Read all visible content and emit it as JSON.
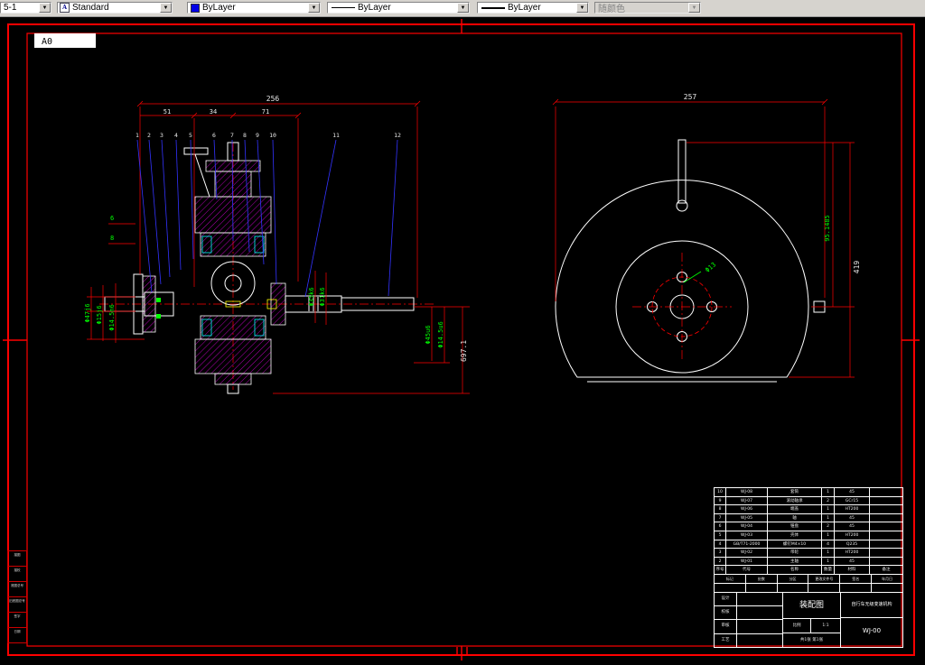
{
  "toolbar": {
    "layer": "5-1",
    "text_style": "Standard",
    "color": "ByLayer",
    "linetype": "ByLayer",
    "lineweight": "ByLayer",
    "plot_style": "随颜色"
  },
  "icons": {
    "text_style_glyph": "A"
  },
  "sheet": {
    "size_label": "A0"
  },
  "left_view": {
    "dim_total": "256",
    "dim_a": "51",
    "dim_b": "34",
    "dim_c": "71",
    "callouts": [
      "1",
      "2",
      "3",
      "4",
      "5",
      "6",
      "7",
      "8",
      "9",
      "10",
      "11",
      "12"
    ],
    "fit_left": [
      "Φ47j6",
      "Φ15j6",
      "Φ14.5n6"
    ],
    "fit_mid": [
      "Φ35k6",
      "Φ31k6"
    ],
    "fit_right": [
      "Φ45u6",
      "Φ14.5u6"
    ],
    "dim_right": "697.1",
    "notes": [
      "6",
      "8"
    ]
  },
  "right_view": {
    "dim_total": "257",
    "dim_v1": "95.1485",
    "dim_v2": "419",
    "hole": "Φ13"
  },
  "title_block": {
    "bom": {
      "rows": [
        [
          "10",
          "WJ-08",
          "套筒",
          "1",
          "45",
          ""
        ],
        [
          "9",
          "WJ-07",
          "滚动轴承",
          "2",
          "GCr15",
          ""
        ],
        [
          "8",
          "WJ-06",
          "端盖",
          "1",
          "HT200",
          ""
        ],
        [
          "7",
          "WJ-05",
          "轴",
          "1",
          "45",
          ""
        ],
        [
          "6",
          "WJ-04",
          "锥盘",
          "2",
          "45",
          ""
        ],
        [
          "5",
          "WJ-03",
          "壳体",
          "1",
          "HT200",
          ""
        ],
        [
          "4",
          "GB/T71-2000",
          "螺钉M4×10",
          "4",
          "Q235",
          ""
        ],
        [
          "3",
          "WJ-02",
          "带轮",
          "1",
          "HT200",
          ""
        ],
        [
          "2",
          "WJ-01",
          "主轴",
          "1",
          "45",
          ""
        ],
        [
          "序号",
          "代号",
          "名称",
          "数量",
          "材料",
          "备注"
        ]
      ]
    },
    "sign_row": [
      "标记",
      "处数",
      "分区",
      "更改文件号",
      "签名",
      "年月日"
    ],
    "left_cells": [
      "设计",
      "校核",
      "审核",
      "工艺"
    ],
    "title": "装配图",
    "subtitle": "自行车无级变速机构",
    "scale_label": "比例",
    "scale": "1:1",
    "sheet_info": "共1张 第1张",
    "drawing_no": "WJ-00"
  },
  "frame": {
    "left_strip": [
      "描图",
      "描校",
      "底图总号",
      "旧底图总号",
      "签字",
      "日期"
    ]
  }
}
